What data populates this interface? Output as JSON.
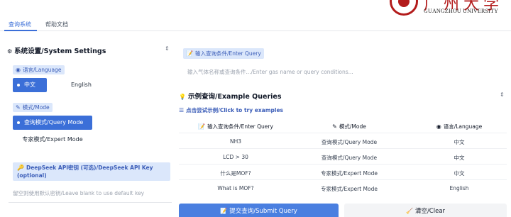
{
  "logo": {
    "cn": "广州大学",
    "en": "GUANGZHOU UNIVERSITY"
  },
  "tabs": [
    {
      "label": "查询系统"
    },
    {
      "label": "帮助文档"
    }
  ],
  "settings": {
    "title": "系统设置/System Settings",
    "language": {
      "label": "语言/Language",
      "options": [
        "中文",
        "English"
      ],
      "selected": "中文"
    },
    "mode": {
      "label": "模式/Mode",
      "options": [
        "查询模式/Query Mode",
        "专家模式/Expert Mode"
      ],
      "selected": "查询模式/Query Mode"
    },
    "api": {
      "label": "DeepSeek API密钥 (可选)/DeepSeek API Key (optional)",
      "placeholder": "留空则使用默认密钥/Leave blank to use default key"
    }
  },
  "query": {
    "label": "输入查询条件/Enter Query",
    "placeholder": "输入气体名称或查询条件.../Enter gas name or query conditions..."
  },
  "examples": {
    "title": "示例查询/Example Queries",
    "hint": "点击尝试示例/Click to try examples",
    "headers": [
      "输入查询条件/Enter Query",
      "模式/Mode",
      "语言/Language"
    ],
    "rows": [
      [
        "NH3",
        "查询模式/Query Mode",
        "中文"
      ],
      [
        "LCD > 30",
        "查询模式/Query Mode",
        "中文"
      ],
      [
        "什么是MOF?",
        "专家模式/Expert Mode",
        "中文"
      ],
      [
        "What is MOF?",
        "专家模式/Expert Mode",
        "English"
      ]
    ]
  },
  "buttons": {
    "submit": "提交查询/Submit Query",
    "clear": "清空/Clear"
  }
}
